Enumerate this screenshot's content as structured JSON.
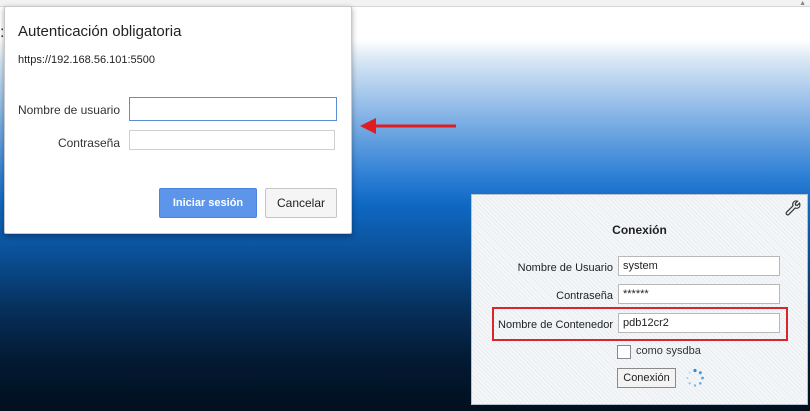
{
  "auth_dialog": {
    "title": "Autenticación obligatoria",
    "url": "https://192.168.56.101:5500",
    "username_label": "Nombre de usuario",
    "username_value": "",
    "password_label": "Contraseña",
    "password_value": "",
    "login_button": "Iniciar sesión",
    "cancel_button": "Cancelar"
  },
  "annotations": {
    "arrow_color": "#e01b22",
    "highlight_color": "#d9262a"
  },
  "connection_panel": {
    "title": "Conexión",
    "username_label": "Nombre de Usuario",
    "username_value": "system",
    "password_label": "Contraseña",
    "password_value": "******",
    "container_label": "Nombre de Contenedor",
    "container_value": "pdb12cr2",
    "sysdba_label": "como sysdba",
    "sysdba_checked": false,
    "connect_button": "Conexión",
    "icons": [
      "wrench-icon",
      "spinner-icon"
    ]
  },
  "colors": {
    "primary_button": "#5c95ea",
    "background_top": "#ffffff",
    "background_mid": "#0f68c2",
    "background_bottom": "#020f1f"
  }
}
